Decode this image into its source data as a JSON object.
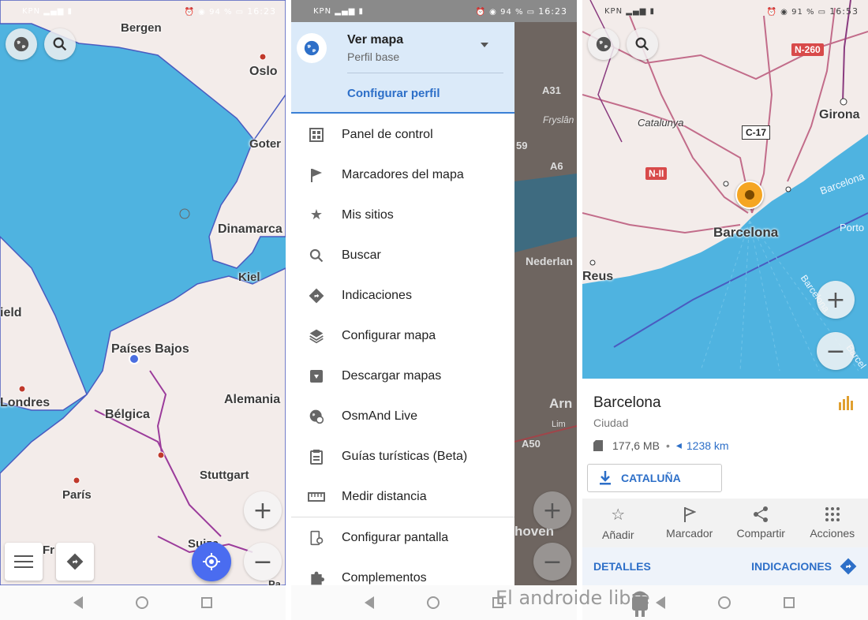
{
  "watermark": "El androide libre",
  "screen1": {
    "status": {
      "carrier": "KPN",
      "battery": "94 %",
      "time": "16:23"
    },
    "labels": {
      "bergen": "Bergen",
      "oslo": "Oslo",
      "goter": "Goter",
      "dinamarca": "Dinamarca",
      "kiel": "Kiel",
      "ield": "ield",
      "paises_bajos": "Países Bajos",
      "londres": "Londres",
      "belgica": "Bélgica",
      "alemania": "Alemania",
      "stuttgart": "Stuttgart",
      "paris": "París",
      "fr": "Fr",
      "suiza": "Suiza",
      "pa": "Pa"
    }
  },
  "screen2": {
    "status": {
      "carrier": "KPN",
      "battery": "94 %",
      "time": "16:23"
    },
    "header": {
      "title": "Ver mapa",
      "subtitle": "Perfil base",
      "configure": "Configurar perfil"
    },
    "items": [
      {
        "label": "Panel de control",
        "icon": "dashboard-icon"
      },
      {
        "label": "Marcadores del mapa",
        "icon": "flag-icon"
      },
      {
        "label": "Mis sitios",
        "icon": "star-icon"
      },
      {
        "label": "Buscar",
        "icon": "search-icon"
      },
      {
        "label": "Indicaciones",
        "icon": "directions-icon"
      },
      {
        "label": "Configurar mapa",
        "icon": "layers-icon"
      },
      {
        "label": "Descargar mapas",
        "icon": "download-icon"
      },
      {
        "label": "OsmAnd Live",
        "icon": "globe-refresh-icon"
      },
      {
        "label": "Guías turísticas (Beta)",
        "icon": "clipboard-icon"
      },
      {
        "label": "Medir distancia",
        "icon": "ruler-icon"
      },
      {
        "label": "Configurar pantalla",
        "icon": "screen-settings-icon"
      },
      {
        "label": "Complementos",
        "icon": "puzzle-icon"
      }
    ],
    "behind_map": {
      "a31": "A31",
      "frysian": "Fryslân",
      "n59": "59",
      "a6": "A6",
      "nederlan": "Nederlan",
      "arn": "Arn",
      "a50": "A50",
      "hoven": "hoven",
      "lim": "Lim"
    }
  },
  "screen3": {
    "status": {
      "carrier": "KPN",
      "battery": "91 %",
      "time": "16:53"
    },
    "labels": {
      "n260": "N-260",
      "girona": "Girona",
      "catalunya": "Catalunya",
      "c17": "C-17",
      "n2": "N-II",
      "barcelona_map": "Barcelona",
      "reus": "Reus",
      "porto": "Porto",
      "barcelona_sea1": "Barcelona",
      "barcelona_sea2": "Barcelona",
      "barcel": "Barcel"
    },
    "card": {
      "title": "Barcelona",
      "type": "Ciudad",
      "size": "177,6 MB",
      "distance": "1238 km",
      "download_label": "CATALUÑA",
      "actions": [
        {
          "label": "Añadir",
          "icon": "star-outline-icon"
        },
        {
          "label": "Marcador",
          "icon": "flag-outline-icon"
        },
        {
          "label": "Compartir",
          "icon": "share-icon"
        },
        {
          "label": "Acciones",
          "icon": "grid-dots-icon"
        }
      ],
      "details": "DETALLES",
      "directions": "INDICACIONES"
    },
    "colors": {
      "accent": "#2d6fc8",
      "marker": "#f5a623"
    }
  }
}
